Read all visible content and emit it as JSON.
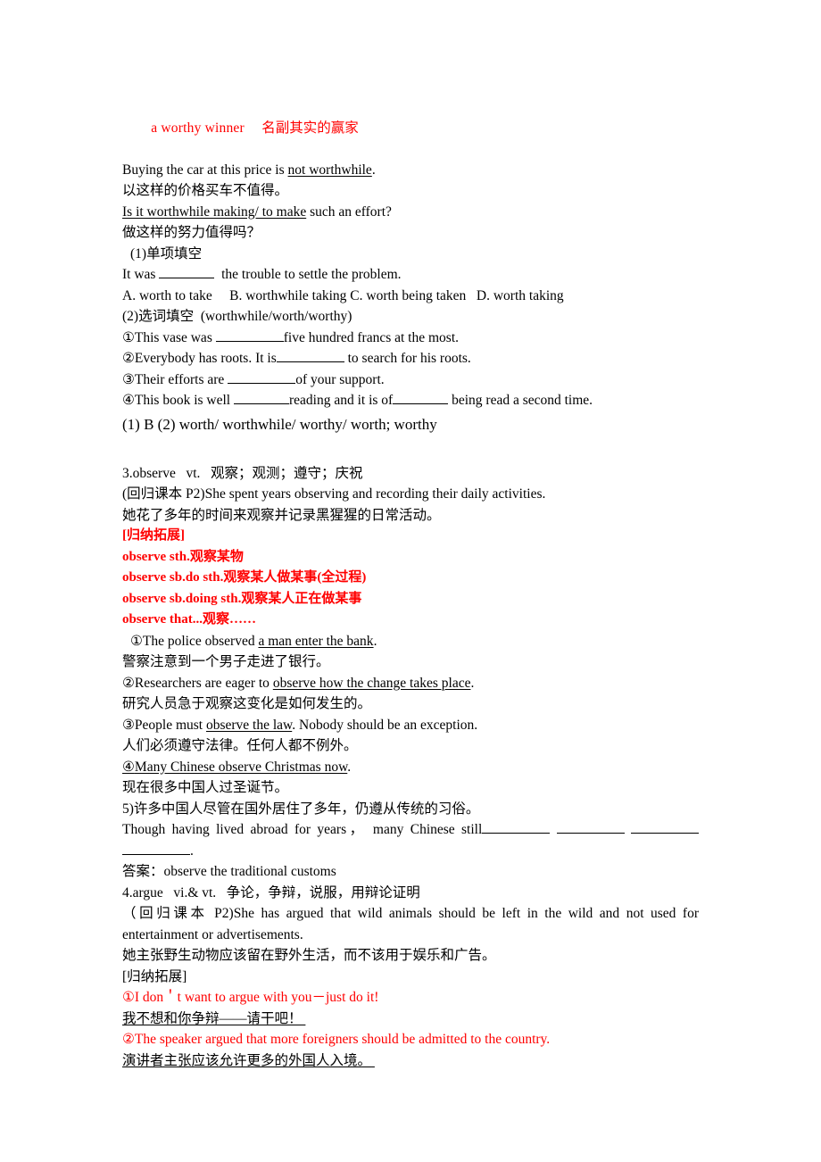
{
  "document": {
    "colors": {
      "red": "#ff0000",
      "text": "#000000",
      "background": "#ffffff"
    },
    "worthy_section": {
      "heading_en": "a worthy winner",
      "heading_zh": "名副其实的赢家",
      "example1_en": "Buying the car at this price is not worthwhile.",
      "example1_en_plain": "Buying the car at this price is ",
      "example1_en_underlined": "not worthwhile",
      "example1_en_tail": ".",
      "example1_zh": "以这样的价格买车不值得。",
      "example2_underlined": "Is it worthwhile making/ to make",
      "example2_tail": " such an effort?",
      "example2_zh": "做这样的努力值得吗？",
      "exercise1_label": "(1)单项填空",
      "exercise1_stem_a": "It was ",
      "exercise1_stem_b": "  the trouble to settle the problem.",
      "exercise1_options": "A. worth to take     B. worthwhile taking C. worth being taken   D. worth taking",
      "exercise2_label": "(2)选词填空（worthwhile/worth/worthy）",
      "exercise2_label_display": "(2)选词填空  (worthwhile/worth/worthy)",
      "item1_a": "①This vase was ",
      "item1_b": "five hundred francs at the most.",
      "item2_a": "②Everybody has roots. It is",
      "item2_b": " to search for his roots.",
      "item3_a": "③Their efforts are ",
      "item3_b": "of your support.",
      "item4_a": "④This book is well ",
      "item4_b": "reading and it is of",
      "item4_c": " being read a second time.",
      "answers": "(1) B (2) worth/ worthwhile/ worthy/ worth; worthy"
    },
    "observe_section": {
      "entry": "3.observe   vt.   观察；观测；遵守；庆祝",
      "textbook_ref_en": "(回归课本 P2)She spent years observing and recording their daily activities.",
      "textbook_ref_zh": "她花了多年的时间来观察并记录黑猩猩的日常活动。",
      "expansion_label": "[归纳拓展]",
      "patterns": [
        "observe sth.观察某物",
        "observe sb.do sth.观察某人做某事(全过程)",
        "observe sb.doing sth.观察某人正在做某事",
        "observe that...观察……"
      ],
      "ex1_a": "①The police observed ",
      "ex1_u": "a man enter the bank",
      "ex1_b": ".",
      "ex1_zh": "警察注意到一个男子走进了银行。",
      "ex2_a": "②Researchers are eager to ",
      "ex2_u": "observe how the change takes place",
      "ex2_b": ".",
      "ex2_zh": "研究人员急于观察这变化是如何发生的。",
      "ex3_a": "③People must ",
      "ex3_u": "observe the law",
      "ex3_b": ". Nobody should be an exception.",
      "ex3_zh": "人们必须遵守法律。任何人都不例外。",
      "ex4_num": "④",
      "ex4_u": "Many Chinese observe Christmas now",
      "ex4_b": ".",
      "ex4_zh": "现在很多中国人过圣诞节。",
      "ex5_zh": "5)许多中国人尽管在国外居住了多年，仍遵从传统的习俗。",
      "ex5_en_a": "Though having lived abroad for years， many Chinese still",
      "ex5_en_cont": ".",
      "ex5_answer": "答案：observe the traditional customs"
    },
    "argue_section": {
      "entry": "4.argue   vi.& vt.   争论，争辩，说服，用辩论证明",
      "textbook_ref_en": "（回归课本 P2)She has argued that wild animals should be left in the wild and not used for entertainment or advertisements.",
      "textbook_ref_zh": "她主张野生动物应该留在野外生活，而不该用于娱乐和广告。",
      "expansion_label": "[归纳拓展]",
      "ex1_en": "①I don＇t want to argue with you－just do it!",
      "ex1_zh": "我不想和你争辩——请干吧！",
      "ex2_en": "②The speaker argued that more foreigners should be admitted to the country.",
      "ex2_zh": "演讲者主张应该允许更多的外国人入境。"
    }
  }
}
